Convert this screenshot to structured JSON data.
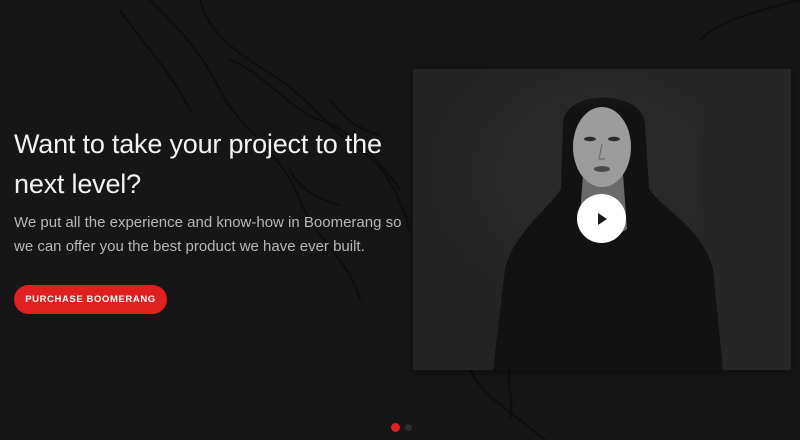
{
  "hero": {
    "title": "Want to take your project to the next level?",
    "description": "We put all the experience and know-how in Boomerang so we can offer you the best product we have ever built.",
    "cta_label": "PURCHASE BOOMERANG"
  },
  "video": {
    "play_icon": "play-icon"
  },
  "slider": {
    "active_index": 1,
    "total": 2
  },
  "colors": {
    "background": "#161616",
    "accent": "#e0201f",
    "card": "#262626"
  }
}
